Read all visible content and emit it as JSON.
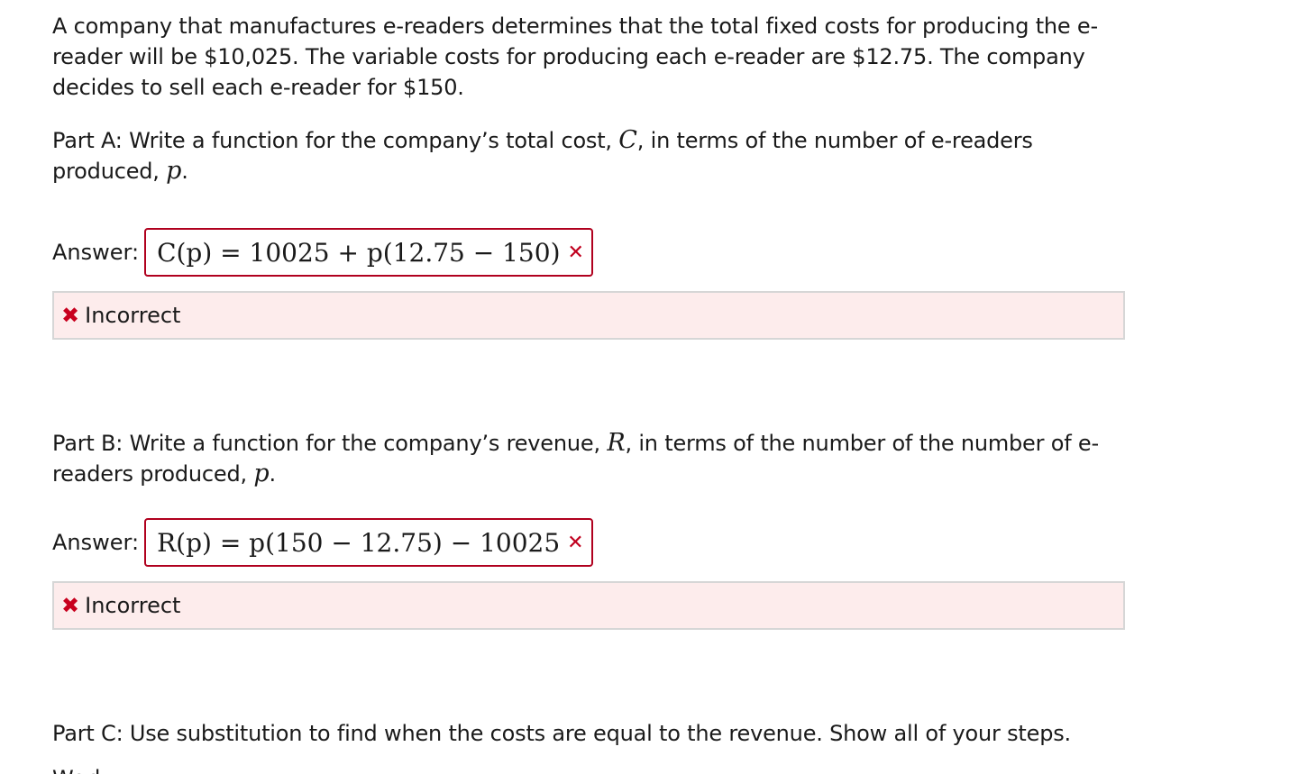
{
  "intro_text": "A company that manufactures e-readers determines that the total fixed costs for producing the e-reader will be $10,025. The variable costs for producing each e-reader are $12.75. The company decides to sell each e-reader for $150.",
  "part_a": {
    "prompt_before": "Part A: Write a function for the company’s total cost, ",
    "var_c": "C",
    "prompt_mid": ", in terms of the number of e-readers produced, ",
    "var_p": "p",
    "prompt_end": ".",
    "answer_label": "Answer:",
    "answer_value": "C(p) = 10025 + p(12.75 − 150)",
    "answer_mark": "✕",
    "feedback_icon": "✖",
    "feedback_text": "Incorrect"
  },
  "part_b": {
    "prompt_before": "Part B: Write a function for the company’s revenue, ",
    "var_r": "R",
    "prompt_mid": ", in terms of the number of the number of e-readers produced, ",
    "var_p": "p",
    "prompt_end": ".",
    "answer_label": "Answer:",
    "answer_value": "R(p) = p(150 − 12.75) − 10025",
    "answer_mark": "✕",
    "feedback_icon": "✖",
    "feedback_text": "Incorrect"
  },
  "part_c": {
    "prompt": "Part C: Use substitution to find when the costs are equal to the revenue. Show all of your steps.",
    "work_label": "Work:"
  },
  "colors": {
    "error_red": "#c0001e",
    "feedback_bg": "#fdecec",
    "box_border": "#b0001e"
  }
}
